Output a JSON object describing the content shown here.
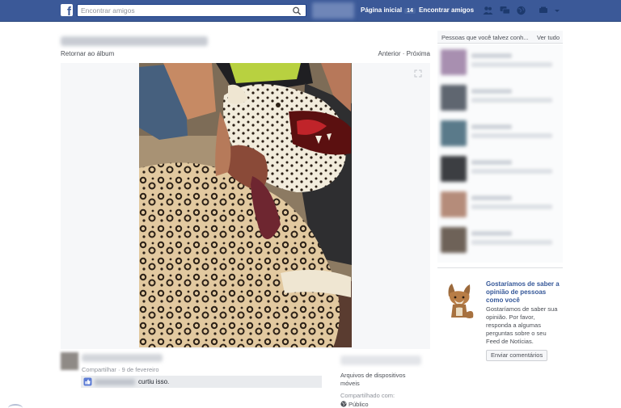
{
  "topbar": {
    "logo": "f",
    "search_placeholder": "Encontrar amigos",
    "home_label": "Página inicial",
    "home_count": "14",
    "find_friends_label": "Encontrar amigos"
  },
  "photo_view": {
    "back_link": "Retornar ao álbum",
    "prev_label": "Anterior",
    "separator": "·",
    "next_label": "Próxima",
    "share_label": "Compartilhar",
    "meta_separator": "·",
    "date": "9 de fevereiro",
    "like_text": "curtiu isso."
  },
  "album_info": {
    "album_name": "Arquivos de dispositivos móveis",
    "shared_with_label": "Compartilhado com:",
    "privacy": "Público"
  },
  "sidebar": {
    "pymk_title": "Pessoas que você talvez conh...",
    "see_all": "Ver tudo",
    "people": [
      {
        "color": "#a88fb0"
      },
      {
        "color": "#5f6670"
      },
      {
        "color": "#5a7a8a"
      },
      {
        "color": "#3c3e42"
      },
      {
        "color": "#b58c7a"
      },
      {
        "color": "#6e6258"
      }
    ],
    "feedback": {
      "title": "Gostaríamos de saber a opinião de pessoas como você",
      "text": "Gostaríamos de saber sua opinião. Por favor, responda a algumas perguntas sobre o seu Feed de Notícias.",
      "button": "Enviar comentários"
    }
  },
  "colors": {
    "brand": "#3b5998",
    "link": "#365899"
  }
}
